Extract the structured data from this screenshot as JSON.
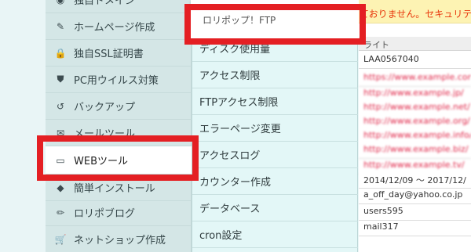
{
  "sidebar": {
    "items": [
      {
        "label": "独自ドメイン",
        "icon": "globe-icon",
        "glyph": "◉"
      },
      {
        "label": "ホームページ作成",
        "icon": "edit-icon",
        "glyph": "✎"
      },
      {
        "label": "独自SSL証明書",
        "icon": "lock-icon",
        "glyph": "🔒"
      },
      {
        "label": "PC用ウイルス対策",
        "icon": "shield-icon",
        "glyph": "⛊"
      },
      {
        "label": "バックアップ",
        "icon": "history-icon",
        "glyph": "↺"
      },
      {
        "label": "メールツール",
        "icon": "envelope-icon",
        "glyph": "✉"
      },
      {
        "label": "WEBツール",
        "icon": "monitor-icon",
        "glyph": "▭"
      },
      {
        "label": "簡単インストール",
        "icon": "download-icon",
        "glyph": "◆"
      },
      {
        "label": "ロリポブログ",
        "icon": "pencil-icon",
        "glyph": "✏"
      },
      {
        "label": "ネットショップ作成",
        "icon": "cart-icon",
        "glyph": "🛒"
      }
    ]
  },
  "menu": {
    "items": [
      "ロリポップ！FTP",
      "ディスク使用量",
      "アクセス制限",
      "FTPアクセス制限",
      "エラーページ変更",
      "アクセスログ",
      "カウンター作成",
      "データベース",
      "cron設定"
    ]
  },
  "content": {
    "notice": "ておりません。セキュリティ",
    "column_header": "ライト",
    "rows": [
      {
        "text": "LAA0567040",
        "blurred": false
      },
      {
        "text": "https://www.example.com/",
        "blurred": true
      },
      {
        "text": "http://www.example.jp/",
        "blurred": true
      },
      {
        "text": "http://www.example.net/",
        "blurred": true
      },
      {
        "text": "http://www.example.org/",
        "blurred": true
      },
      {
        "text": "http://www.example.info/",
        "blurred": true
      },
      {
        "text": "http://www.example.biz/",
        "blurred": true
      },
      {
        "text": "http://www.example.tv/",
        "blurred": true
      },
      {
        "text": "2014/12/09 ～ 2017/12/",
        "blurred": false
      },
      {
        "text": "a_off_day@yahoo.co.jp",
        "blurred": false
      },
      {
        "text": "users595",
        "blurred": false
      },
      {
        "text": "mail317",
        "blurred": false
      }
    ]
  },
  "colors": {
    "highlight": "#e41f23",
    "notice_text": "#e8380d",
    "sidebar_bg": "#d4e6e6",
    "menu_bg": "#e3f7f7"
  }
}
